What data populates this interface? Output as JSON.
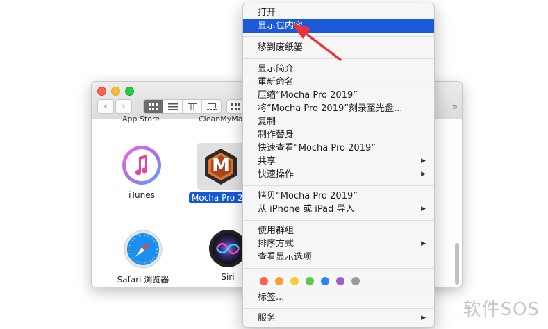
{
  "finder": {
    "toolbar": {
      "back": "‹",
      "forward": "›",
      "more": "»"
    },
    "cut_labels": [
      "App Store",
      "CleanMyMa"
    ],
    "apps": [
      {
        "label": "iTunes"
      },
      {
        "label": "Mocha Pro 2"
      },
      {
        "label": "Safari 浏览器"
      },
      {
        "label": "Siri"
      }
    ],
    "mocha_letter": "M"
  },
  "menu": {
    "items": [
      {
        "label": "打开"
      },
      {
        "label": "显示包内容",
        "highlighted": true
      },
      {
        "label": "移到废纸篓"
      },
      {
        "label": "显示简介"
      },
      {
        "label": "重新命名"
      },
      {
        "label": "压缩“Mocha Pro 2019”"
      },
      {
        "label": "将“Mocha Pro 2019”刻录至光盘..."
      },
      {
        "label": "复制"
      },
      {
        "label": "制作替身"
      },
      {
        "label": "快速查看“Mocha Pro 2019”"
      },
      {
        "label": "共享",
        "submenu": true
      },
      {
        "label": "快速操作",
        "submenu": true
      },
      {
        "label": "拷贝“Mocha Pro 2019”"
      },
      {
        "label": "从 iPhone 或 iPad 导入",
        "submenu": true
      },
      {
        "label": "使用群组"
      },
      {
        "label": "排序方式",
        "submenu": true
      },
      {
        "label": "查看显示选项"
      },
      {
        "label": "标签..."
      },
      {
        "label": "服务",
        "submenu": true
      }
    ],
    "submenu_glyph": "▶",
    "tag_colors": [
      "#fc5f57",
      "#f99d2b",
      "#f8cc34",
      "#5dc84c",
      "#2f85f7",
      "#a55ad2",
      "#9a9a9a"
    ]
  },
  "watermark": "软件SOS",
  "colors": {
    "highlight": "#1a5ad7",
    "arrow": "#e8333a"
  }
}
